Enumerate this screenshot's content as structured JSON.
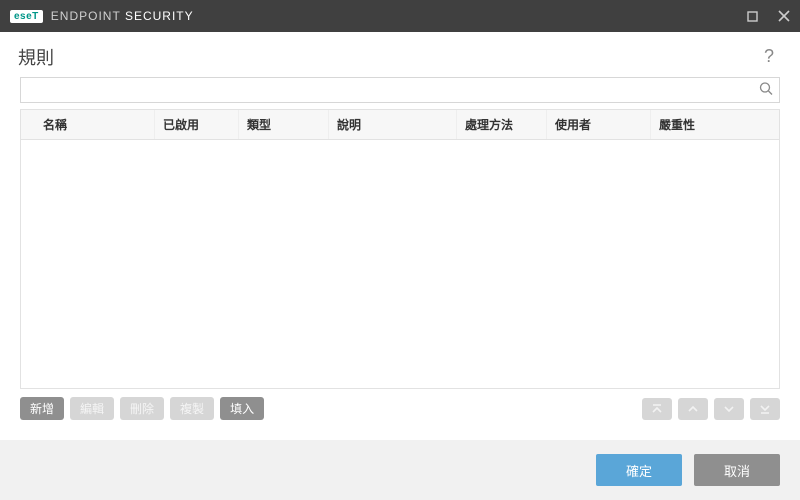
{
  "titlebar": {
    "logo_badge": "eseT",
    "product_light": "ENDPOINT",
    "product_bold": "SECURITY"
  },
  "header": {
    "title": "規則"
  },
  "search": {
    "placeholder": ""
  },
  "columns": {
    "c0": "名稱",
    "c1": "已啟用",
    "c2": "類型",
    "c3": "說明",
    "c4": "處理方法",
    "c5": "使用者",
    "c6": "嚴重性"
  },
  "actions": {
    "add": "新增",
    "edit": "編輯",
    "delete": "刪除",
    "copy": "複製",
    "populate": "填入"
  },
  "footer": {
    "ok": "確定",
    "cancel": "取消"
  }
}
